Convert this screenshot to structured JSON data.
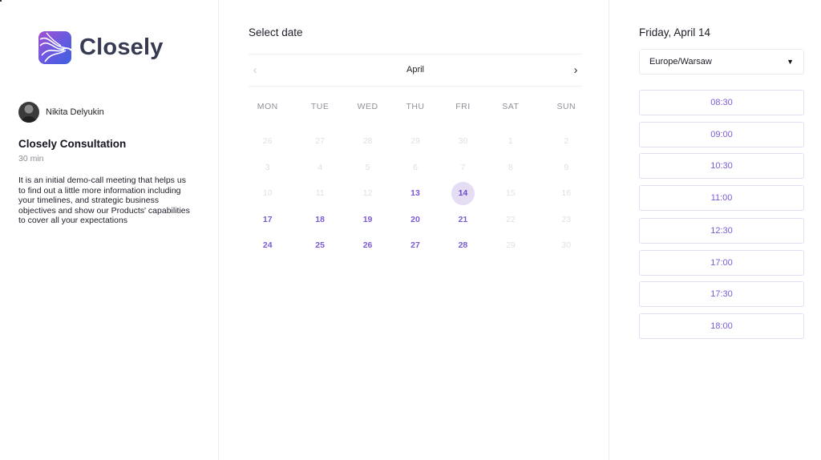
{
  "brand": {
    "name": "Closely",
    "logo_icon": "closely-logo-icon",
    "gradient": [
      "#a24fd1",
      "#3d5fe0"
    ]
  },
  "host": {
    "name": "Nikita Delyukin",
    "avatar_icon": "user-avatar"
  },
  "event": {
    "title": "Closely Consultation",
    "duration": "30 min",
    "description": "It is an initial demo-call meeting that helps us to find out a little more information including your timelines, and strategic business objectives and show our Products' capabilities to cover all your expectations"
  },
  "calendar": {
    "heading": "Select date",
    "month": "April",
    "prev_icon": "chevron-left-icon",
    "next_icon": "chevron-right-icon",
    "weekdays": [
      "MON",
      "TUE",
      "WED",
      "THU",
      "FRI",
      "SAT",
      "SUN"
    ],
    "accent_color": "#7b5ad6",
    "selected_bg": "#e4ddf4",
    "days": [
      {
        "label": "26",
        "state": "disabled"
      },
      {
        "label": "27",
        "state": "disabled"
      },
      {
        "label": "28",
        "state": "disabled"
      },
      {
        "label": "29",
        "state": "disabled"
      },
      {
        "label": "30",
        "state": "disabled"
      },
      {
        "label": "1",
        "state": "disabled"
      },
      {
        "label": "2",
        "state": "disabled"
      },
      {
        "label": "3",
        "state": "disabled"
      },
      {
        "label": "4",
        "state": "disabled"
      },
      {
        "label": "5",
        "state": "disabled"
      },
      {
        "label": "6",
        "state": "disabled"
      },
      {
        "label": "7",
        "state": "disabled"
      },
      {
        "label": "8",
        "state": "disabled"
      },
      {
        "label": "9",
        "state": "disabled"
      },
      {
        "label": "10",
        "state": "disabled"
      },
      {
        "label": "11",
        "state": "disabled"
      },
      {
        "label": "12",
        "state": "disabled"
      },
      {
        "label": "13",
        "state": "available"
      },
      {
        "label": "14",
        "state": "selected"
      },
      {
        "label": "15",
        "state": "disabled"
      },
      {
        "label": "16",
        "state": "disabled"
      },
      {
        "label": "17",
        "state": "available"
      },
      {
        "label": "18",
        "state": "available"
      },
      {
        "label": "19",
        "state": "available"
      },
      {
        "label": "20",
        "state": "available"
      },
      {
        "label": "21",
        "state": "available"
      },
      {
        "label": "22",
        "state": "disabled"
      },
      {
        "label": "23",
        "state": "disabled"
      },
      {
        "label": "24",
        "state": "available"
      },
      {
        "label": "25",
        "state": "available"
      },
      {
        "label": "26",
        "state": "available"
      },
      {
        "label": "27",
        "state": "available"
      },
      {
        "label": "28",
        "state": "available"
      },
      {
        "label": "29",
        "state": "disabled"
      },
      {
        "label": "30",
        "state": "disabled"
      }
    ]
  },
  "schedule": {
    "selected_date": "Friday, April 14",
    "timezone": {
      "value": "Europe/Warsaw",
      "icon": "dropdown-triangle-icon",
      "arrow_glyph": "▼"
    },
    "slots": [
      "08:30",
      "09:00",
      "10:30",
      "11:00",
      "12:30",
      "17:00",
      "17:30",
      "18:00"
    ]
  }
}
